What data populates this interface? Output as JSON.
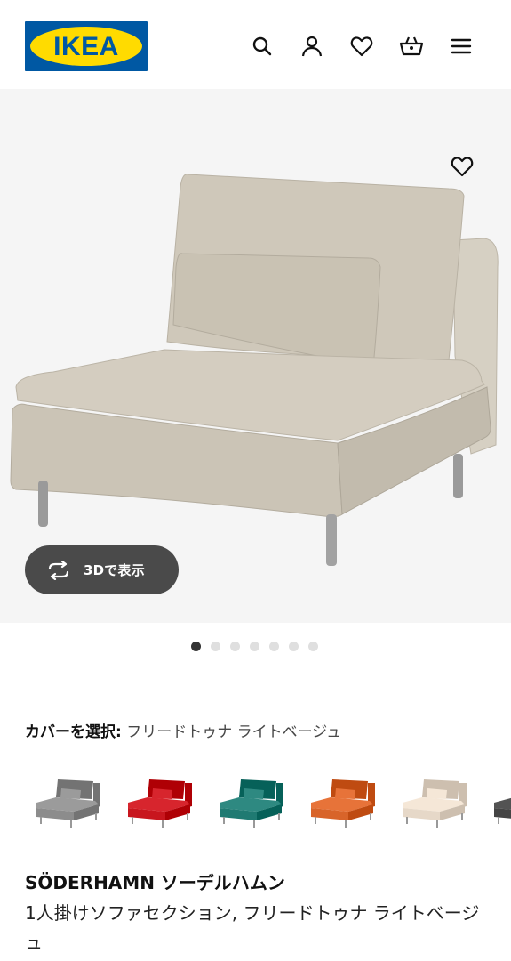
{
  "header": {
    "logo_text": "IKEA",
    "icons": [
      "search-icon",
      "account-icon",
      "favorites-icon",
      "cart-icon",
      "menu-icon"
    ]
  },
  "gallery": {
    "view_3d_label": "3Dで表示",
    "image_count": 7,
    "active_index": 0
  },
  "cover": {
    "label": "カバーを選択:",
    "value": "フリードトゥナ ライトベージュ",
    "swatches": [
      {
        "color": "#8c8c8c"
      },
      {
        "color": "#c8161e"
      },
      {
        "color": "#1f7a72"
      },
      {
        "color": "#d8642a"
      },
      {
        "color": "#e6d8c8"
      },
      {
        "color": "#444444"
      }
    ]
  },
  "product": {
    "name": "SÖDERHAMN ソーデルハムン",
    "description": "1人掛けソファセクション, フリードトゥナ ライトベージュ"
  },
  "colors": {
    "ikea_blue": "#0058A3",
    "ikea_yellow": "#FFDB00",
    "sofa_beige": "#cdc6b8"
  }
}
